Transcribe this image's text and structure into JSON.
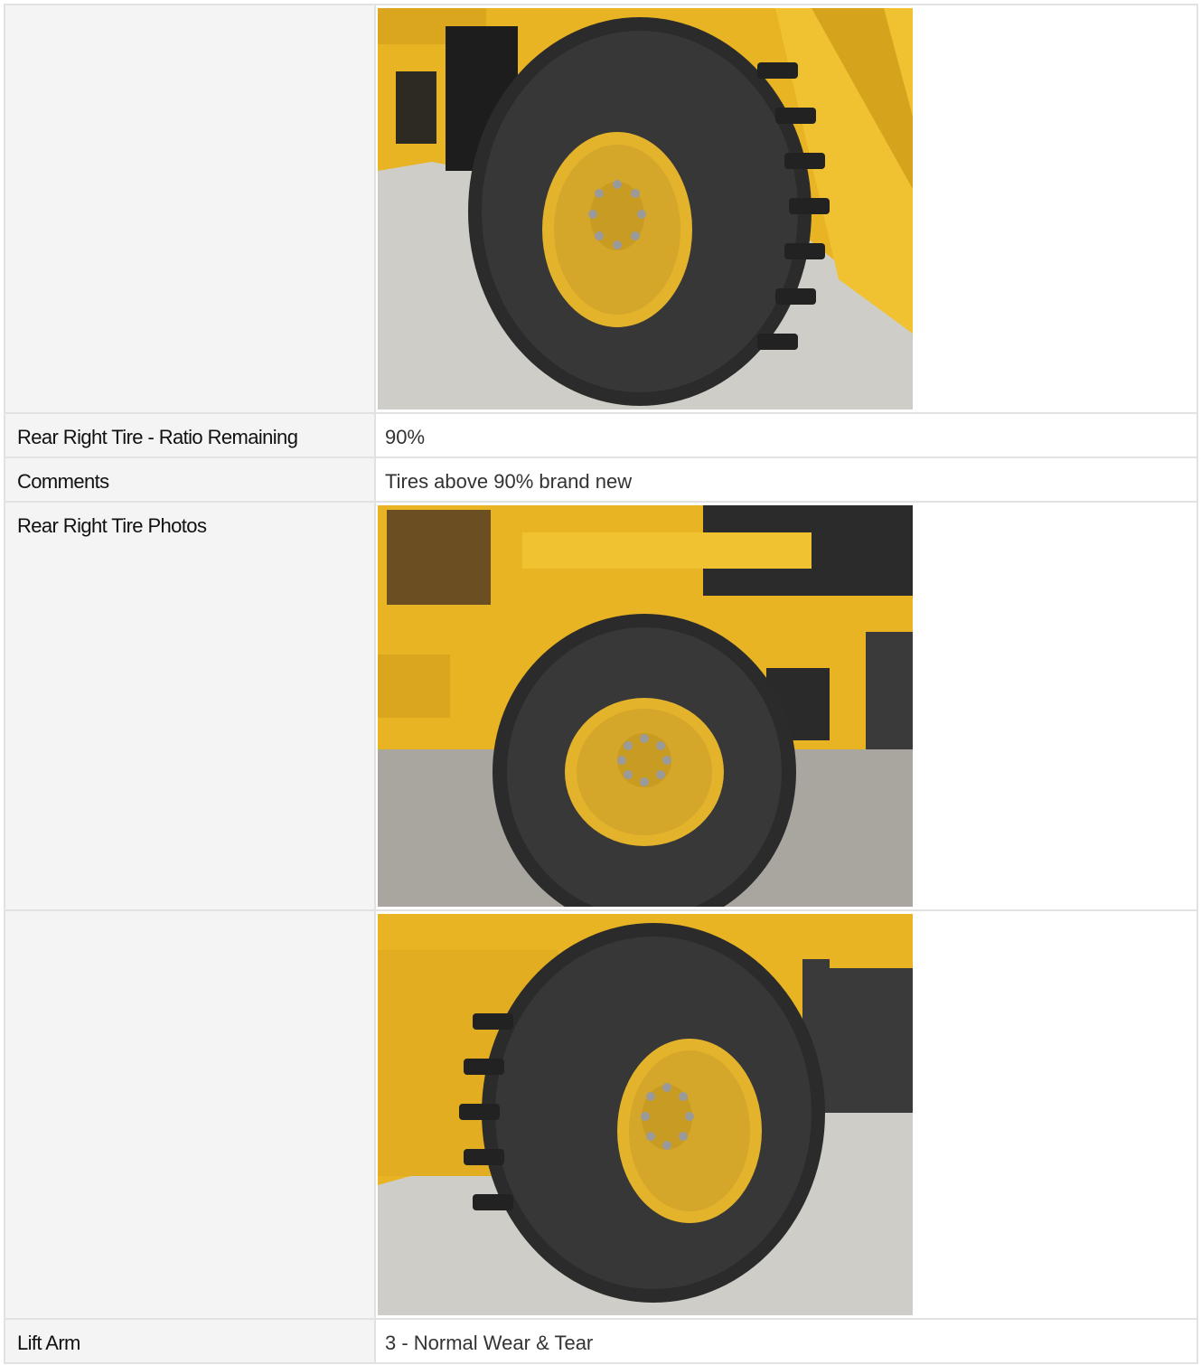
{
  "rows": [
    {
      "type": "photo",
      "label": "",
      "photo": "tire-wheel-photo"
    },
    {
      "type": "text",
      "label": "Rear Right Tire - Ratio Remaining",
      "value": "90%"
    },
    {
      "type": "text",
      "label": "Comments",
      "value": "Tires above 90% brand new"
    },
    {
      "type": "photo",
      "label": "Rear Right Tire Photos",
      "photo": "tire-wheel-photo"
    },
    {
      "type": "photo",
      "label": "",
      "photo": "tire-wheel-photo"
    },
    {
      "type": "text",
      "label": "Lift Arm",
      "value": "3 - Normal Wear & Tear"
    }
  ],
  "colors": {
    "machine_yellow": "#e8b423",
    "tire_black": "#2b2b2b",
    "rim_yellow": "#e3b32c",
    "concrete": "#cfcdc7",
    "label_bg": "#f4f4f4",
    "border": "#e2e2e2"
  }
}
